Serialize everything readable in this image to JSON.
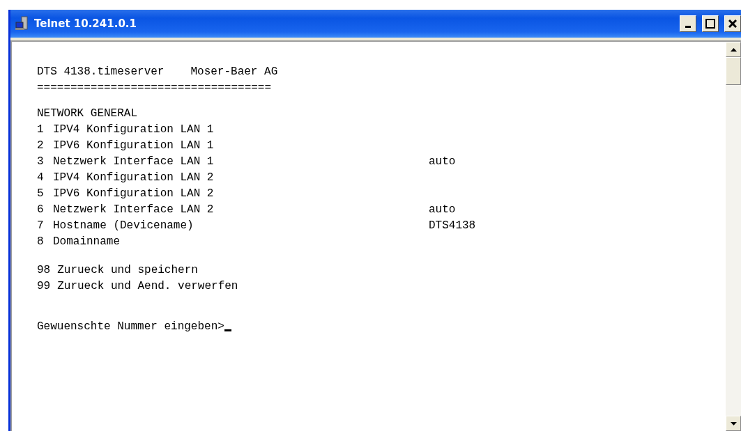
{
  "window": {
    "title": "Telnet 10.241.0.1"
  },
  "terminal": {
    "header": {
      "product": "DTS 4138.timeserver",
      "vendor": "Moser-Baer AG"
    },
    "rule": "===================================",
    "section_title": "NETWORK GENERAL",
    "items": [
      {
        "number": "1",
        "label": "IPV4 Konfiguration LAN 1"
      },
      {
        "number": "2",
        "label": "IPV6 Konfiguration LAN 1"
      },
      {
        "number": "3",
        "label": "Netzwerk Interface LAN 1",
        "value": "auto"
      },
      {
        "number": "4",
        "label": "IPV4 Konfiguration LAN 2"
      },
      {
        "number": "5",
        "label": "IPV6 Konfiguration LAN 2"
      },
      {
        "number": "6",
        "label": "Netzwerk Interface LAN 2",
        "value": "auto"
      },
      {
        "number": "7",
        "label": "Hostname (Devicename)",
        "value": "DTS4138"
      },
      {
        "number": "8",
        "label": "Domainname"
      }
    ],
    "actions": [
      {
        "number": "98",
        "label": "Zurueck und speichern"
      },
      {
        "number": "99",
        "label": "Zurueck und Aend. verwerfen"
      }
    ],
    "prompt": "Gewuenschte Nummer eingeben>"
  }
}
